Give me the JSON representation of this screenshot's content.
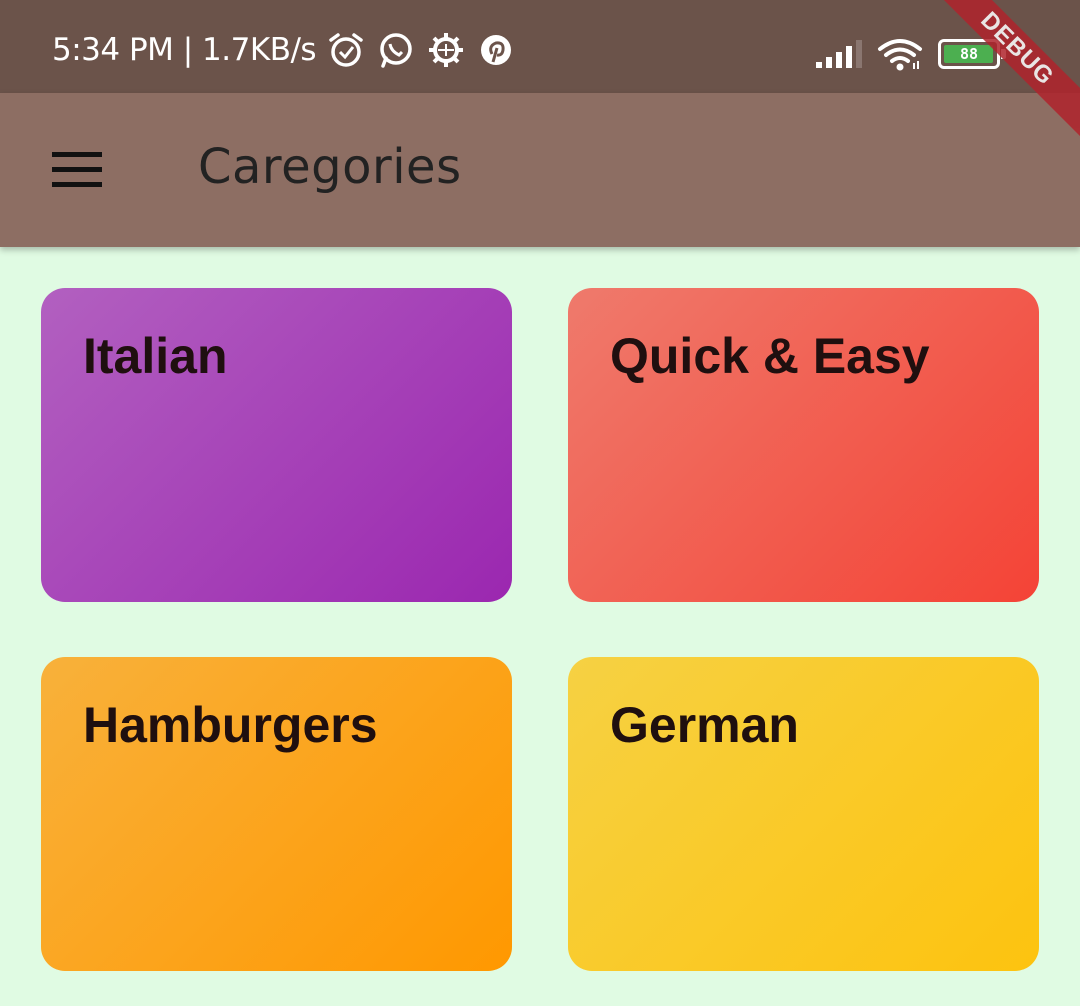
{
  "status_bar": {
    "time_text": "5:34 PM | 1.7KB/s",
    "icons": [
      "alarm-icon",
      "whatsapp-icon",
      "settings-gear-icon",
      "pinterest-icon"
    ],
    "right_icons": [
      "signal-icon",
      "wifi-icon",
      "battery-icon"
    ],
    "battery_level": "88"
  },
  "debug_banner": {
    "label": "DEBUG"
  },
  "app_bar": {
    "title": "Caregories",
    "menu_icon": "hamburger-menu-icon",
    "background": "#8d6e63"
  },
  "categories": [
    {
      "label": "Italian",
      "color": "#9c27b0"
    },
    {
      "label": "Quick & Easy",
      "color": "#f44336"
    },
    {
      "label": "Hamburgers",
      "color": "#ff9800"
    },
    {
      "label": "German",
      "color": "#ffc107"
    }
  ],
  "colors": {
    "status_bar": "#6b534a",
    "page_background": "#e0fbe3"
  }
}
